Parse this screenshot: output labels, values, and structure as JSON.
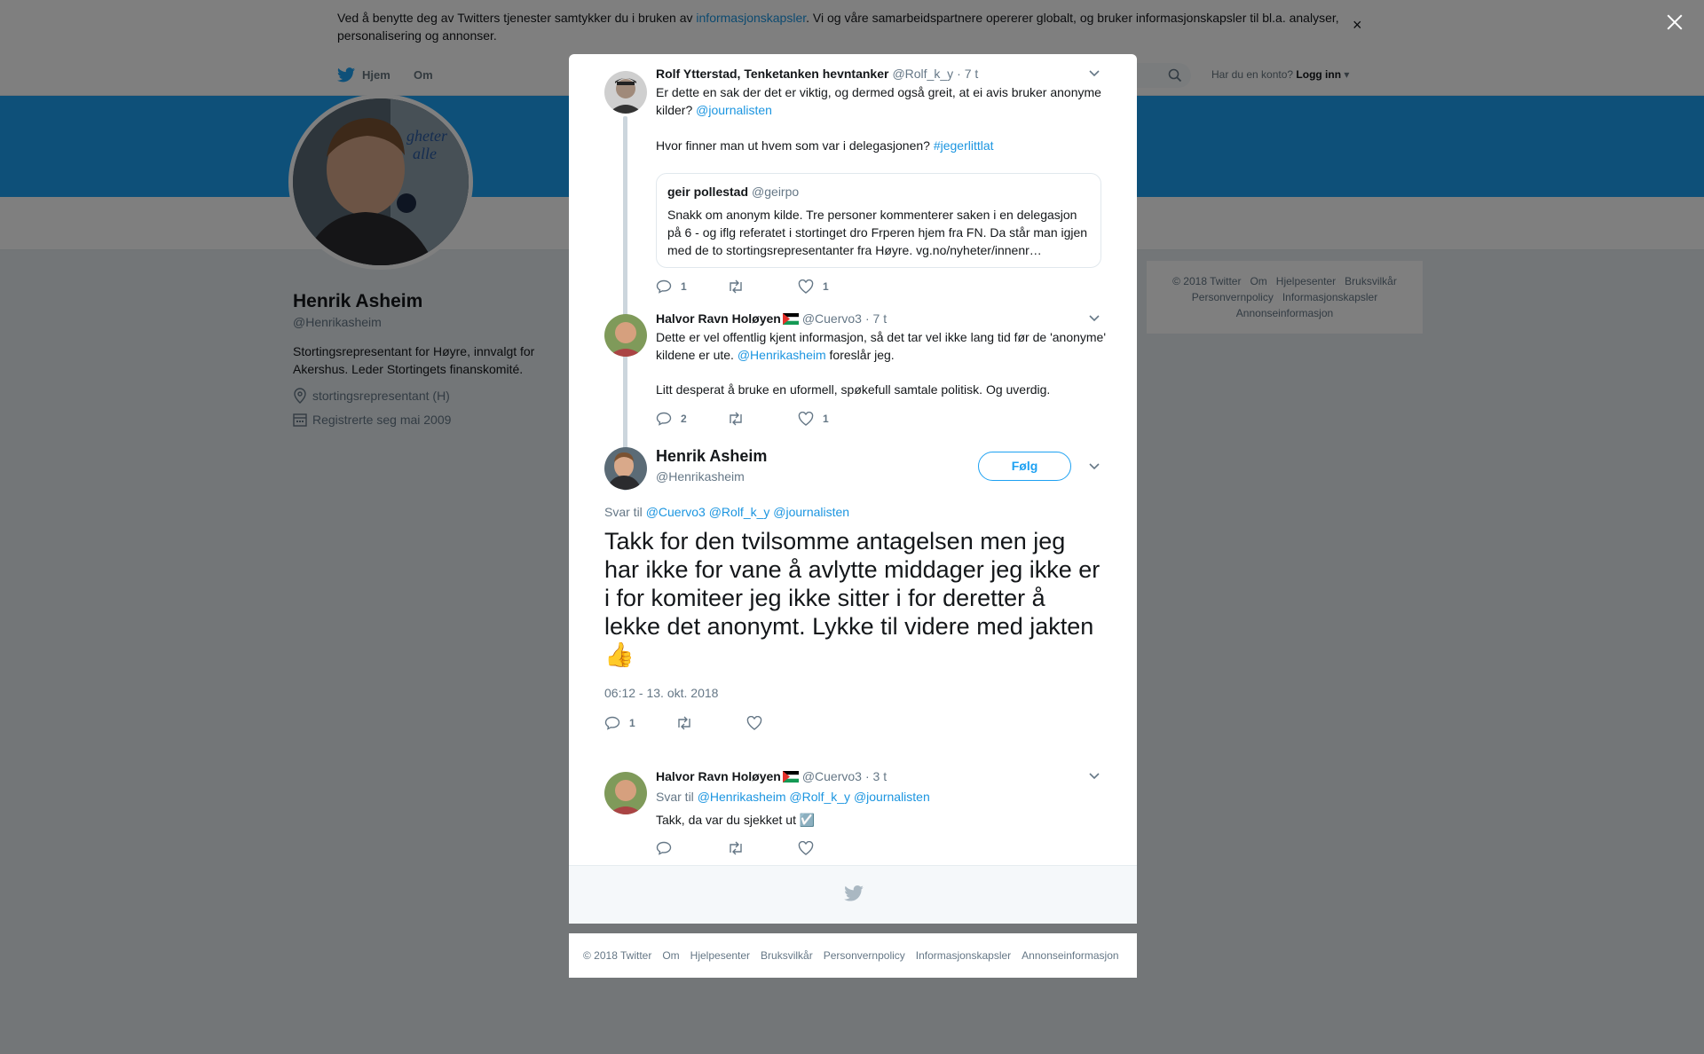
{
  "cookie_banner": {
    "text_before": "Ved å benytte deg av Twitters tjenester samtykker du i bruken av ",
    "link": "informasjonskapsler",
    "text_after": ". Vi og våre samarbeidspartnere opererer globalt, og bruker informasjonskapsler til bl.a. analyser, personalisering og annonser.",
    "close": "×"
  },
  "nav": {
    "home": "Hjem",
    "about": "Om",
    "account_prompt": "Har du en konto?",
    "login": "Logg inn"
  },
  "profile": {
    "name": "Henrik Asheim",
    "handle": "@Henrikasheim",
    "bio": "Stortingsrepresentant for Høyre, innvalgt for Akershus. Leder Stortingets finanskomité.",
    "location": "stortingsrepresentant (H)",
    "joined": "Registrerte seg mai 2009"
  },
  "side_footer": [
    "© 2018 Twitter",
    "Om",
    "Hjelpesenter",
    "Bruksvilkår",
    "Personvernpolicy",
    "Informasjonskapsler",
    "Annonseinformasjon"
  ],
  "tweets": [
    {
      "name": "Rolf Ytterstad, Tenketanken hevntanker",
      "handle": "@Rolf_k_y",
      "time": "· 7 t",
      "text1_before": "Er dette en sak der det er viktig, og dermed også greit, at ei avis bruker anonyme kilder? ",
      "text1_link": "@journalisten",
      "text2_before": "Hvor finner man ut hvem som var i delegasjonen? ",
      "text2_link": "#jegerlittlat",
      "quote": {
        "name": "geir pollestad",
        "handle": "@geirpo",
        "text": "Snakk om anonym kilde. Tre personer kommenterer saken i en delegasjon på 6 - og iflg referatet i stortinget dro Frperen hjem fra FN. Da står man igjen med de to stortingsrepresentanter fra Høyre. vg.no/nyheter/innenr…"
      },
      "replies": "1",
      "likes": "1"
    },
    {
      "name": "Halvor Ravn Holøyen",
      "handle": "@Cuervo3",
      "time": "· 7 t",
      "text1_before": "Dette er vel offentlig kjent informasjon, så det tar vel ikke lang tid før de 'anonyme' kildene er ute. ",
      "text1_link": "@Henrikasheim",
      "text1_after": " foreslår jeg.",
      "text2": "Litt desperat å bruke en uformell, spøkefull samtale politisk. Og uverdig.",
      "replies": "2",
      "likes": "1"
    }
  ],
  "main_tweet": {
    "name": "Henrik Asheim",
    "handle": "@Henrikasheim",
    "follow": "Følg",
    "reply_prefix": "Svar til",
    "reply_to": "@Cuervo3 @Rolf_k_y @journalisten",
    "text": "Takk for den tvilsomme antagelsen men jeg har ikke for vane å avlytte middager jeg ikke er i for komiteer jeg ikke sitter i for deretter å lekke det anonymt. Lykke til videre med jakten 👍",
    "timestamp": "06:12 - 13. okt. 2018",
    "replies": "1"
  },
  "reply_tweet": {
    "name": "Halvor Ravn Holøyen",
    "handle": "@Cuervo3",
    "time": "· 3 t",
    "reply_prefix": "Svar til",
    "reply_to": "@Henrikasheim @Rolf_k_y @journalisten",
    "text": "Takk, da var du sjekket ut ☑️"
  },
  "footer": [
    "© 2018 Twitter",
    "Om",
    "Hjelpesenter",
    "Bruksvilkår",
    "Personvernpolicy",
    "Informasjonskapsler",
    "Annonseinformasjon"
  ],
  "colors": {
    "brand": "#1da1f2",
    "link": "#1b95e0",
    "muted": "#657786"
  }
}
